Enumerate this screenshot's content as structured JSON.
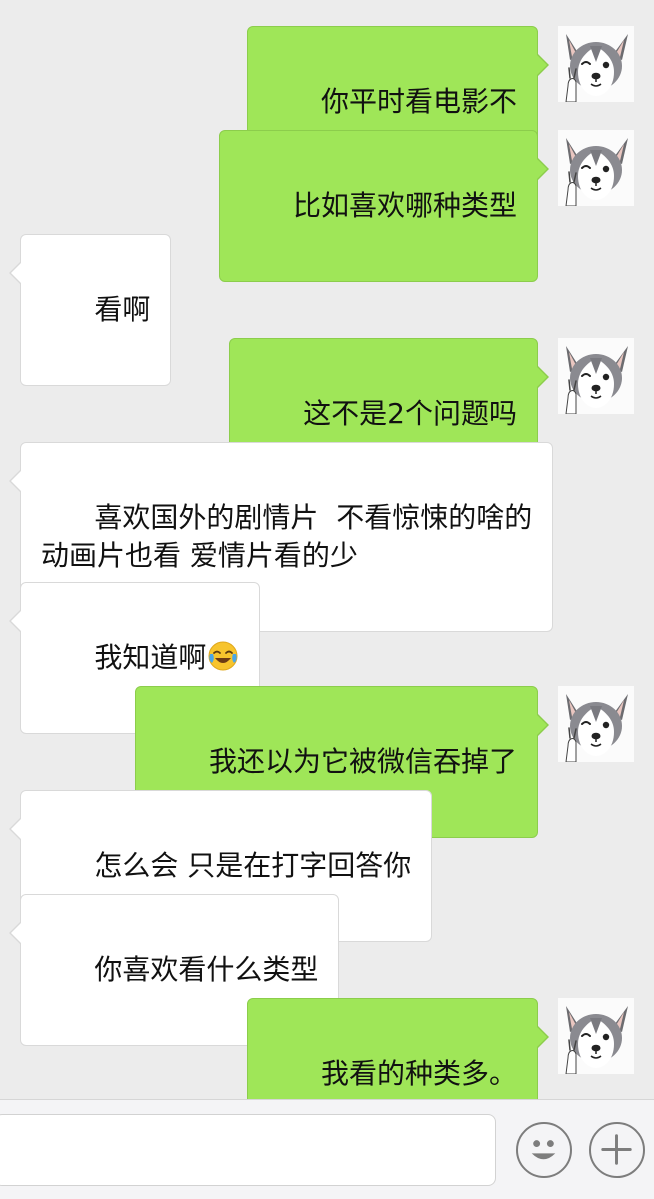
{
  "messages": [
    {
      "side": "right",
      "text": "你平时看电影不"
    },
    {
      "side": "right",
      "text": "比如喜欢哪种类型"
    },
    {
      "side": "left",
      "text": "看啊"
    },
    {
      "side": "right",
      "text": "这不是2个问题吗"
    },
    {
      "side": "left",
      "text": "喜欢国外的剧情片  不看惊悚的啥的\n动画片也看 爱情片看的少"
    },
    {
      "side": "left",
      "text": "我知道啊",
      "emoji": "rolling-laughing-emoji"
    },
    {
      "side": "right",
      "text": "我还以为它被微信吞掉了"
    },
    {
      "side": "left",
      "text": "怎么会 只是在打字回答你"
    },
    {
      "side": "left",
      "text": "你喜欢看什么类型"
    },
    {
      "side": "right",
      "text": "我看的种类多。"
    }
  ],
  "input_bar": {
    "placeholder": "",
    "emoji_button_icon": "smiley-face-icon",
    "more_button_icon": "plus-icon"
  },
  "avatar": {
    "icon": "husky-dog-avatar"
  },
  "colors": {
    "sent_bubble": "#9fe658",
    "received_bubble": "#ffffff",
    "background": "#ececec"
  }
}
